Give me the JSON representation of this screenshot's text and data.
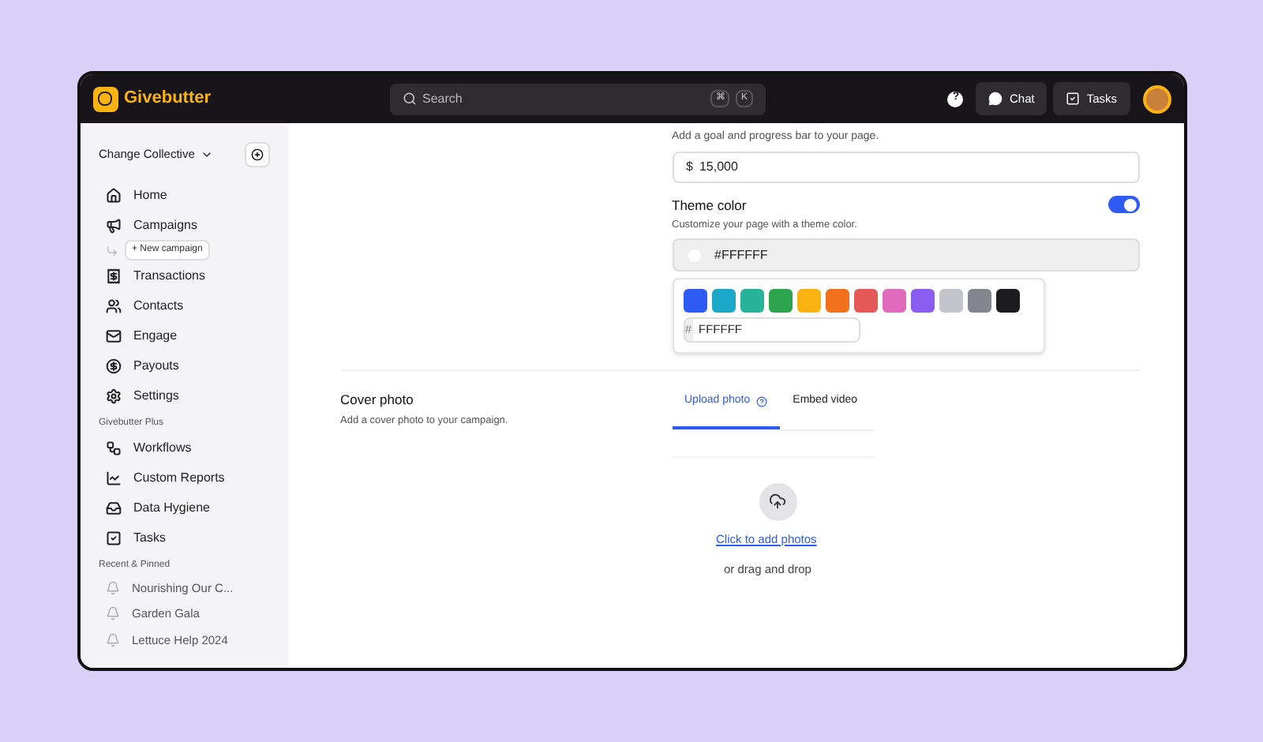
{
  "header": {
    "logo": "Givebutter",
    "search": {
      "placeholder": "Search",
      "keys": [
        "⌘",
        "K"
      ]
    },
    "help": "?",
    "buttons": [
      {
        "kind": "chat",
        "label": "Chat"
      },
      {
        "kind": "tasks",
        "label": "Tasks"
      }
    ]
  },
  "sidebar": {
    "org": "Change Collective",
    "items": [
      {
        "kind": "home",
        "label": "Home"
      },
      {
        "kind": "campaigns",
        "label": "Campaigns",
        "sub": "+ New campaign"
      },
      {
        "kind": "transactions",
        "label": "Transactions"
      },
      {
        "kind": "contacts",
        "label": "Contacts"
      },
      {
        "kind": "engage",
        "label": "Engage"
      },
      {
        "kind": "payouts",
        "label": "Payouts"
      },
      {
        "kind": "settings",
        "label": "Settings"
      }
    ],
    "plus_title": "Givebutter Plus",
    "plus_items": [
      {
        "kind": "workflows",
        "label": "Workflows"
      },
      {
        "kind": "reports",
        "label": "Custom Reports"
      },
      {
        "kind": "hygiene",
        "label": "Data Hygiene"
      },
      {
        "kind": "tasks",
        "label": "Tasks"
      }
    ],
    "recent_title": "Recent & Pinned",
    "recent": [
      "Nourishing Our C...",
      "Garden Gala",
      "Lettuce Help 2024"
    ]
  },
  "goal": {
    "hint": "Add a goal and progress bar to your page.",
    "currency": "$",
    "value": "15,000"
  },
  "theme": {
    "title": "Theme color",
    "on": true,
    "hint": "Customize your page with a theme color.",
    "value": "#FFFFFF",
    "swatches": [
      {
        "color": "#2f5bf5"
      },
      {
        "color": "#1aa7c8"
      },
      {
        "color": "#27b39a"
      },
      {
        "color": "#2ea44f"
      },
      {
        "color": "#fbb311"
      },
      {
        "color": "#f2711c"
      },
      {
        "color": "#e45858"
      },
      {
        "color": "#e06bbd"
      },
      {
        "color": "#8a5cf0"
      },
      {
        "color": "#c4c4cc"
      },
      {
        "color": "#83858f"
      },
      {
        "color": "#1c1c1e"
      }
    ],
    "hash": "#",
    "hex": "FFFFFF"
  },
  "cover": {
    "title": "Cover photo",
    "hint": "Add a cover photo to your campaign.",
    "tabs": [
      {
        "label": "Upload photo",
        "selected": true
      },
      {
        "label": "Embed video",
        "selected": false
      }
    ],
    "link": "Click to add photos",
    "drop": "or drag and drop"
  }
}
